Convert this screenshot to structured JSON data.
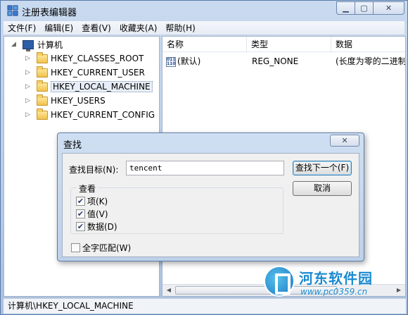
{
  "window": {
    "title": "注册表编辑器"
  },
  "menu": [
    "文件(F)",
    "编辑(E)",
    "查看(V)",
    "收藏夹(A)",
    "帮助(H)"
  ],
  "tree": {
    "root": "计算机",
    "keys": [
      "HKEY_CLASSES_ROOT",
      "HKEY_CURRENT_USER",
      "HKEY_LOCAL_MACHINE",
      "HKEY_USERS",
      "HKEY_CURRENT_CONFIG"
    ],
    "selected": "HKEY_LOCAL_MACHINE"
  },
  "list": {
    "columns": [
      "名称",
      "类型",
      "数据"
    ],
    "rows": [
      {
        "name": "(默认)",
        "type": "REG_NONE",
        "data": "(长度为零的二进制"
      }
    ]
  },
  "statusbar": {
    "path": "计算机\\HKEY_LOCAL_MACHINE"
  },
  "find_dialog": {
    "title": "查找",
    "find_label": "查找目标(N):",
    "find_value": "tencent",
    "find_next": "查找下一个(F)",
    "cancel": "取消",
    "look_at": {
      "title": "查看",
      "options": [
        {
          "label": "项(K)",
          "checked": true
        },
        {
          "label": "值(V)",
          "checked": true
        },
        {
          "label": "数据(D)",
          "checked": true
        }
      ]
    },
    "whole_word": {
      "label": "全字匹配(W)",
      "checked": false
    }
  },
  "watermark": {
    "name": "河东软件园",
    "url": "www.pc0359.cn"
  }
}
